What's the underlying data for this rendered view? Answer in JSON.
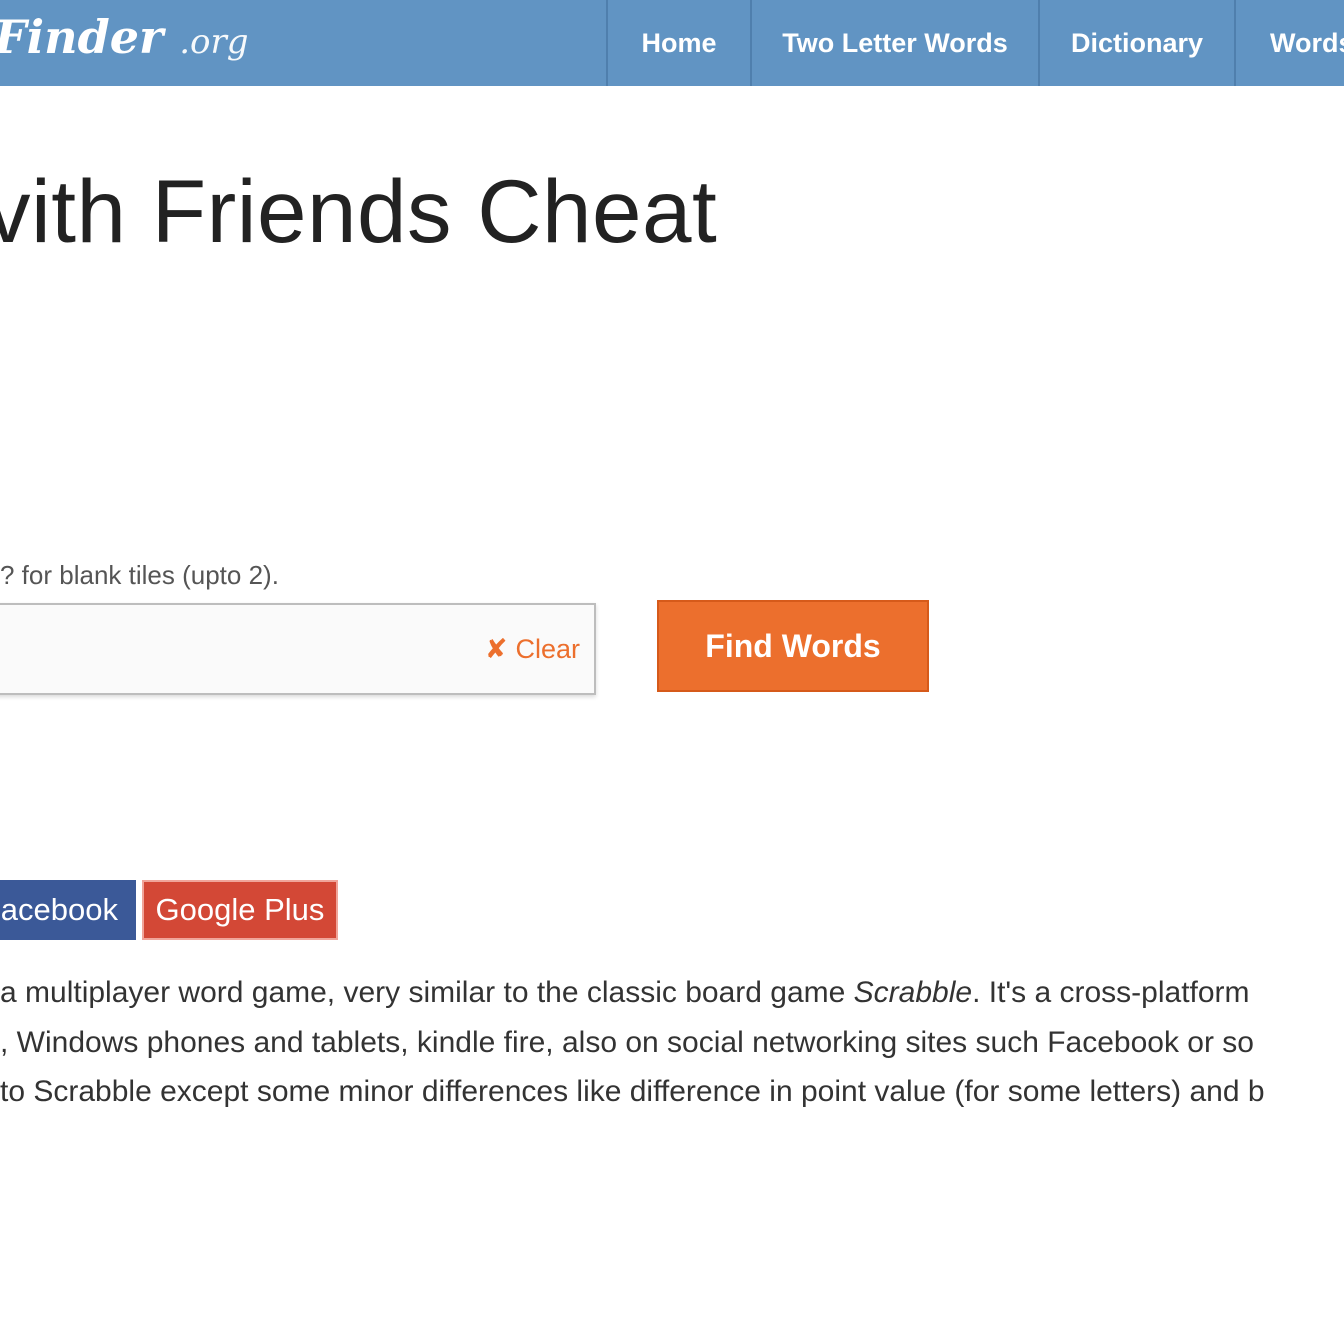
{
  "header": {
    "logo_main": "Finder",
    "logo_suffix": ".org",
    "nav": [
      "Home",
      "Two Letter Words",
      "Dictionary",
      "Words"
    ]
  },
  "main": {
    "title": "vith Friends Cheat",
    "hint": "? for blank tiles (upto 2).",
    "input": {
      "value": "",
      "placeholder": ""
    },
    "clear_icon": "✘",
    "clear_label": "Clear",
    "find_button": "Find Words"
  },
  "share": {
    "facebook": "acebook",
    "google_plus": "Google Plus"
  },
  "description": {
    "line1_before": "a multiplayer word game, very similar to the classic board game ",
    "line1_italic": "Scrabble",
    "line1_after": ". It's a cross-platform",
    "line2": ", Windows phones and tablets, kindle fire, also on social networking sites such Facebook or so",
    "line3": "to Scrabble except some minor differences like difference in point value (for some letters) and b"
  },
  "colors": {
    "navbar": "#6194c3",
    "accent_orange": "#ec6f2d",
    "facebook": "#3b5998",
    "google_plus": "#d34836"
  }
}
